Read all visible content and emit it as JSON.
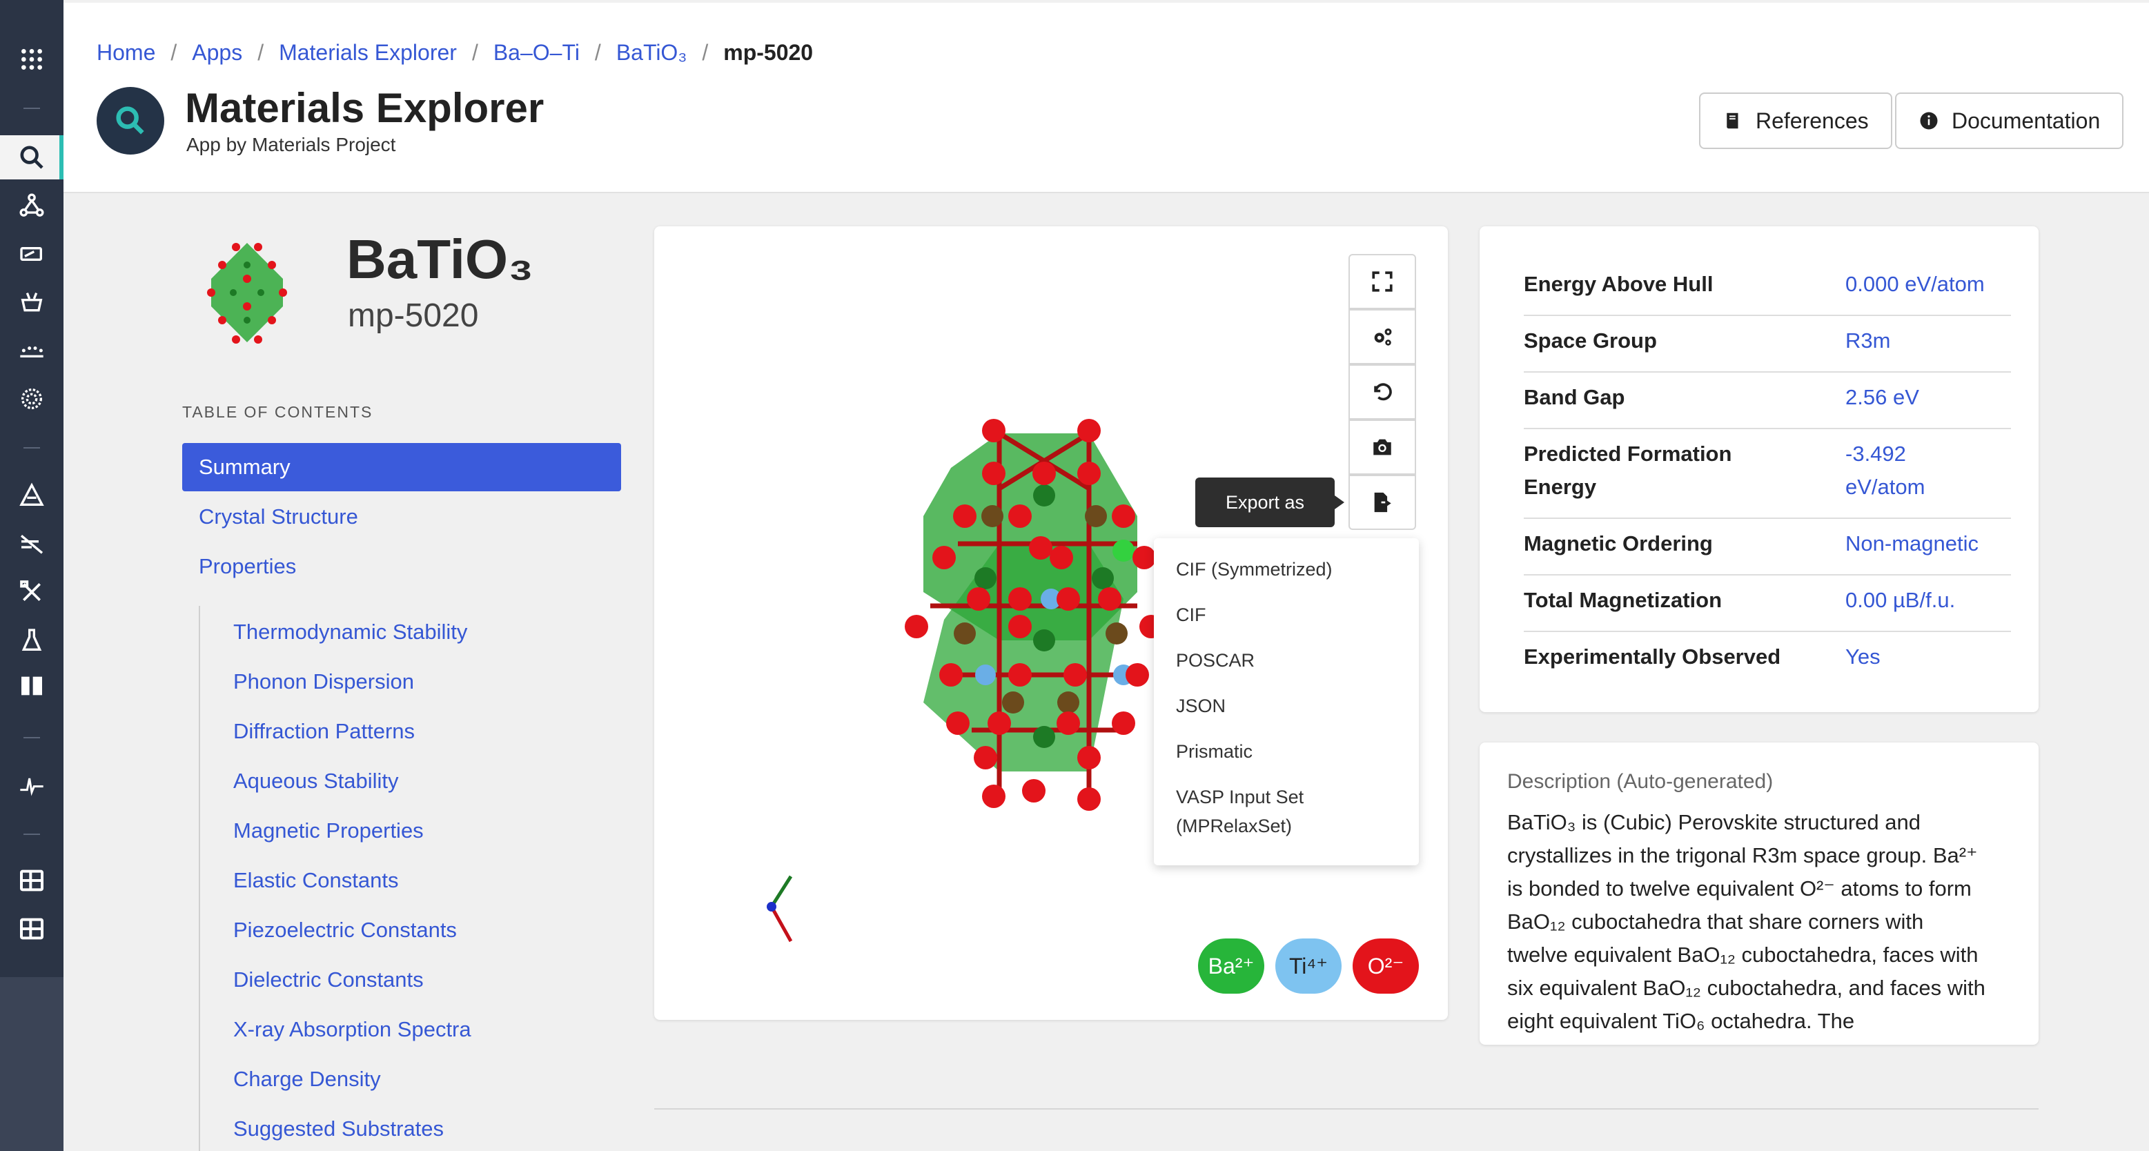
{
  "breadcrumb": [
    "Home",
    "Apps",
    "Materials Explorer",
    "Ba–O–Ti",
    "BaTiO₃",
    "mp-5020"
  ],
  "app": {
    "title": "Materials Explorer",
    "subtitle": "App by Materials Project",
    "references_label": "References",
    "documentation_label": "Documentation"
  },
  "material": {
    "formula": "BaTiO₃",
    "id": "mp-5020"
  },
  "toc": {
    "title": "TABLE OF CONTENTS",
    "items": [
      "Summary",
      "Crystal Structure",
      "Properties"
    ],
    "subitems": [
      "Thermodynamic Stability",
      "Phonon Dispersion",
      "Diffraction Patterns",
      "Aqueous Stability",
      "Magnetic Properties",
      "Elastic Constants",
      "Piezoelectric Constants",
      "Dielectric Constants",
      "X-ray Absorption Spectra",
      "Charge Density",
      "Suggested Substrates"
    ]
  },
  "viewer": {
    "tooltip": "Export as",
    "export_options": [
      "CIF (Symmetrized)",
      "CIF",
      "POSCAR",
      "JSON",
      "Prismatic",
      "VASP Input Set",
      "(MPRelaxSet)"
    ],
    "ions": [
      {
        "label": "Ba²⁺",
        "color": "#27b53a"
      },
      {
        "label": "Ti⁴⁺",
        "color": "#7ec3f0"
      },
      {
        "label": "O²⁻",
        "color": "#e3141b"
      }
    ]
  },
  "properties": [
    {
      "label": "Energy Above Hull",
      "value": "0.000 eV/atom"
    },
    {
      "label": "Space Group",
      "value": "R3m"
    },
    {
      "label": "Band Gap",
      "value": "2.56 eV"
    },
    {
      "label": "Predicted Formation",
      "label2": "Energy",
      "value": "-3.492",
      "value2": "eV/atom"
    },
    {
      "label": "Magnetic Ordering",
      "value": "Non-magnetic"
    },
    {
      "label": "Total Magnetization",
      "value": "0.00 µB/f.u."
    },
    {
      "label": "Experimentally Observed",
      "value": "Yes"
    }
  ],
  "description": {
    "title": "Description (Auto-generated)",
    "lines": [
      "BaTiO₃ is (Cubic) Perovskite structured and",
      "crystallizes in the trigonal R3m space group. Ba²⁺",
      "is bonded to twelve equivalent O²⁻ atoms to form",
      "BaO₁₂ cuboctahedra that share corners with",
      "twelve equivalent BaO₁₂ cuboctahedra, faces with",
      "six equivalent BaO₁₂ cuboctahedra, and faces with",
      "eight equivalent TiO₆ octahedra. The"
    ]
  },
  "colors": {
    "rail": "#2b3445",
    "accent": "#3b5bdb",
    "link": "#3557d4",
    "teal": "#2dbdb3"
  }
}
